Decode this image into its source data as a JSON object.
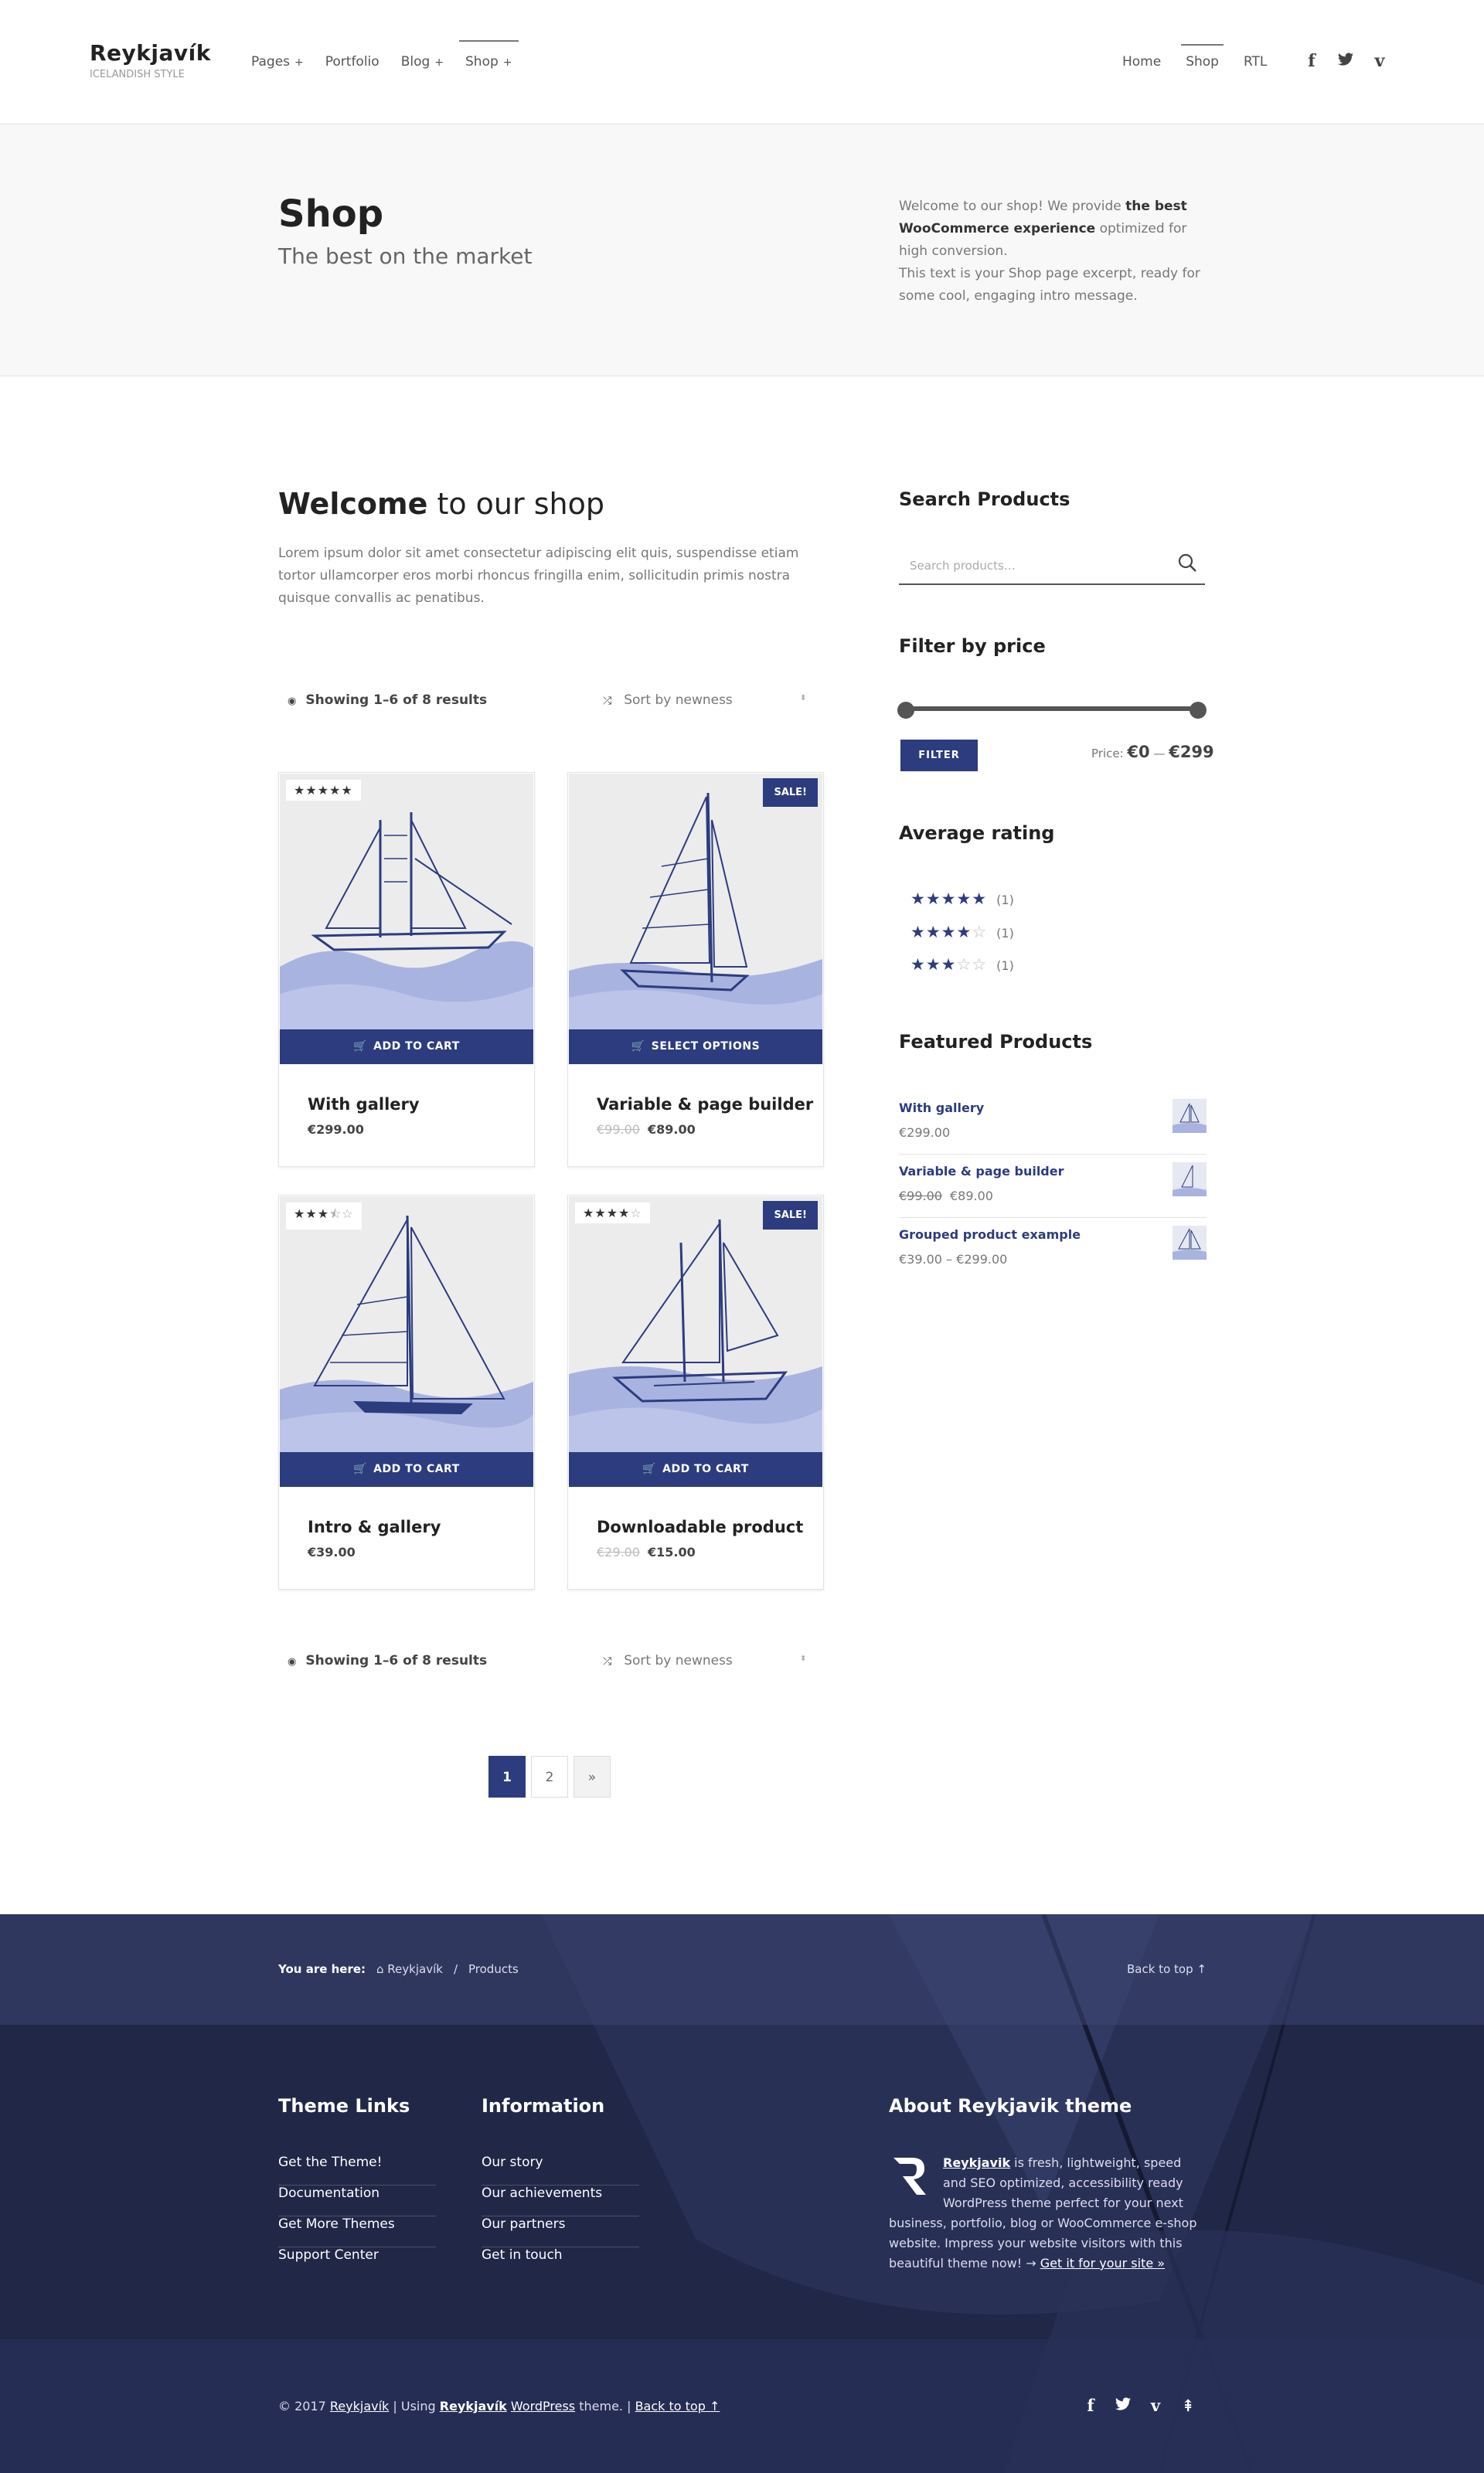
{
  "header": {
    "logo_name": "Reykjavík",
    "logo_tagline": "ICELANDISH STYLE",
    "nav": [
      {
        "label": "Pages"
      },
      {
        "label": "Portfolio"
      },
      {
        "label": "Blog"
      },
      {
        "label": "Shop"
      }
    ],
    "nav_right": [
      {
        "label": "Home"
      },
      {
        "label": "Shop"
      },
      {
        "label": "RTL"
      }
    ],
    "social_icons": [
      "facebook-icon",
      "twitter-icon",
      "vimeo-icon"
    ]
  },
  "hero": {
    "title": "Shop",
    "subtitle": "The best on the market",
    "intro_1": "Welcome to our shop! We provide ",
    "intro_bold": "the best WooCommerce experience",
    "intro_2": " optimized for high conversion.",
    "intro_3": "This text is your Shop page excerpt, ready for some cool, engaging intro message."
  },
  "main": {
    "welcome_bold": "Welcome",
    "welcome_rest": " to our shop",
    "welcome_text": "Lorem ipsum dolor sit amet consectetur adipiscing elit quis, suspendisse etiam tortor ullamcorper eros morbi rhoncus fringilla enim, sollicitudin primis nostra quisque convallis ac penatibus.",
    "results_text": "Showing 1–6 of 8 results",
    "sort_text": "Sort by newness",
    "products": [
      {
        "title": "With gallery",
        "price": "€299.00",
        "old_price": "",
        "rating": 5,
        "badge": "",
        "button": "ADD TO CART"
      },
      {
        "title": "Variable & page builder",
        "price": "€89.00",
        "old_price": "€99.00",
        "rating": 0,
        "badge": "SALE!",
        "button": "SELECT OPTIONS"
      },
      {
        "title": "Intro & gallery",
        "price": "€39.00",
        "old_price": "",
        "rating": 3.5,
        "badge": "",
        "button": "ADD TO CART"
      },
      {
        "title": "Downloadable product",
        "price": "€15.00",
        "old_price": "€29.00",
        "rating": 4,
        "badge": "SALE!",
        "button": "ADD TO CART"
      }
    ],
    "pagination": {
      "current": "1",
      "page2": "2",
      "next": "»"
    }
  },
  "sidebar": {
    "search_title": "Search Products",
    "search_placeholder": "Search products…",
    "filter_title": "Filter by price",
    "filter_button": "FILTER",
    "price_label": "Price: ",
    "price_min": "€0",
    "price_dash": " — ",
    "price_max": "€299",
    "rating_title": "Average rating",
    "ratings": [
      {
        "stars": 5,
        "count": "(1)"
      },
      {
        "stars": 4,
        "count": "(1)"
      },
      {
        "stars": 3,
        "count": "(1)"
      }
    ],
    "featured_title": "Featured Products",
    "featured": [
      {
        "name": "With gallery",
        "price": "€299.00",
        "old_price": ""
      },
      {
        "name": "Variable & page builder",
        "price": "€89.00",
        "old_price": "€99.00"
      },
      {
        "name": "Grouped product example",
        "price": "€39.00 – €299.00",
        "old_price": ""
      }
    ]
  },
  "footer": {
    "you_are_here": "You are here:",
    "crumb_home": "Reykjavík",
    "crumb_sep": "/",
    "crumb_current": "Products",
    "back_to_top": "Back to top ↑",
    "col1_title": "Theme Links",
    "col1_links": [
      "Get the Theme!",
      "Documentation",
      "Get More Themes",
      "Support Center"
    ],
    "col2_title": "Information",
    "col2_links": [
      "Our story",
      "Our achievements",
      "Our partners",
      "Get in touch"
    ],
    "about_title": "About Reykjavik theme",
    "about_brand": "Reykjavik",
    "about_text": " is fresh, lightweight, speed and SEO optimized, accessibility ready WordPress theme perfect for your next business, portfolio, blog or WooCommerce e-shop website. Impress your website visitors with this beautiful theme now! → ",
    "about_link": "Get it for your site »",
    "copy_1": "© 2017 ",
    "copy_site": "Reykjavík",
    "copy_2": " | Using ",
    "copy_theme": "Reykjavík",
    "copy_3": " ",
    "copy_wp": "WordPress",
    "copy_4": " theme. | ",
    "copy_back": "Back to top ↑",
    "social_icons": [
      "facebook-icon",
      "twitter-icon",
      "vimeo-icon",
      "back-to-top-icon"
    ]
  },
  "colors": {
    "accent": "#2c3c7e",
    "footer_bg": "#202747",
    "hero_bg": "#f8f8f8"
  }
}
